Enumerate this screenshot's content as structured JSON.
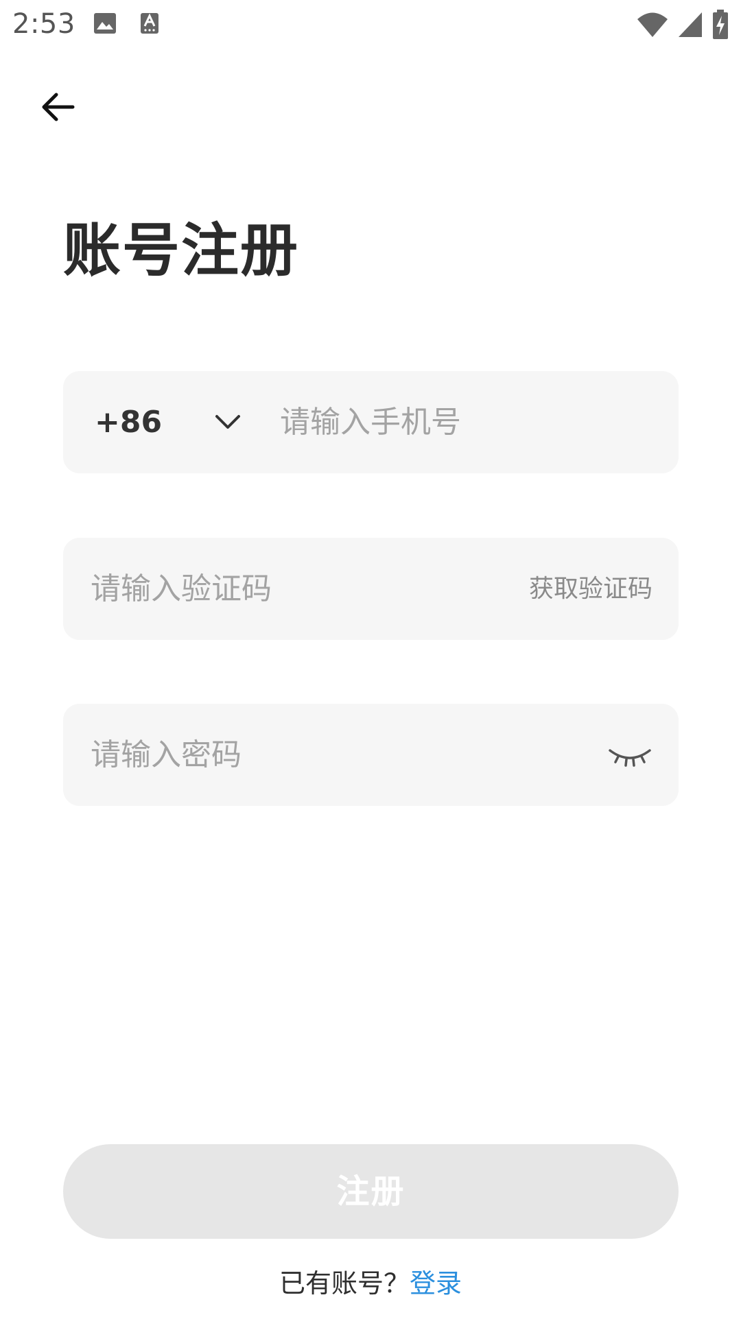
{
  "status_bar": {
    "time": "2:53",
    "icons": [
      "image-icon",
      "keyboard-a-icon",
      "wifi-icon",
      "signal-icon",
      "battery-charging-icon"
    ]
  },
  "nav": {
    "back_icon": "arrow-left-icon"
  },
  "title": "账号注册",
  "phone_field": {
    "country_code": "+86",
    "placeholder": "请输入手机号",
    "value": ""
  },
  "code_field": {
    "placeholder": "请输入验证码",
    "value": "",
    "get_code_label": "获取验证码"
  },
  "password_field": {
    "placeholder": "请输入密码",
    "value": "",
    "toggle_icon": "eye-closed-icon"
  },
  "register_button": {
    "label": "注册"
  },
  "footer": {
    "prompt": "已有账号？",
    "login_link": "登录"
  },
  "colors": {
    "field_background": "#f6f6f6",
    "placeholder": "#a3a3a3",
    "button_disabled": "#e6e6e6",
    "link": "#2b8fde",
    "title": "#2b2b2b"
  }
}
